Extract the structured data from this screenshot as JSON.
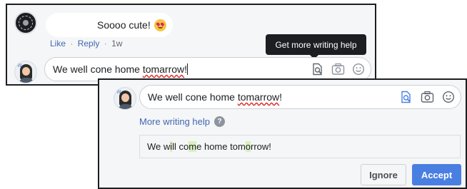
{
  "comment": {
    "text": "Soooo cute!",
    "emoji": "heart-eyes-emoji",
    "actions": {
      "like": "Like",
      "separator": "·",
      "reply": "Reply",
      "time": "1w"
    }
  },
  "tooltip": {
    "text": "Get more writing help"
  },
  "composer_back": {
    "text_before": "We well cone home ",
    "misspelled": "tomarrow",
    "text_after": "!"
  },
  "composer_front": {
    "text_before": "We well cone home ",
    "misspelled": "tomarrow",
    "text_after": "!"
  },
  "writing_help": {
    "link_label": "More writing help",
    "help_icon": "?",
    "suggestion": {
      "p1": "We w",
      "h1": "i",
      "p2": "ll co",
      "h2": "m",
      "p3": "e home tom",
      "h3": "o",
      "p4": "rrow!"
    },
    "ignore_label": "Ignore",
    "accept_label": "Accept"
  },
  "icons": [
    "writing-help-icon",
    "camera-icon",
    "smiley-icon"
  ],
  "colors": {
    "link": "#4267b2",
    "accept": "#4a7fe2",
    "tooltip_bg": "#1c1e21",
    "highlight": "#d9efbe",
    "misspell": "#e02424"
  }
}
